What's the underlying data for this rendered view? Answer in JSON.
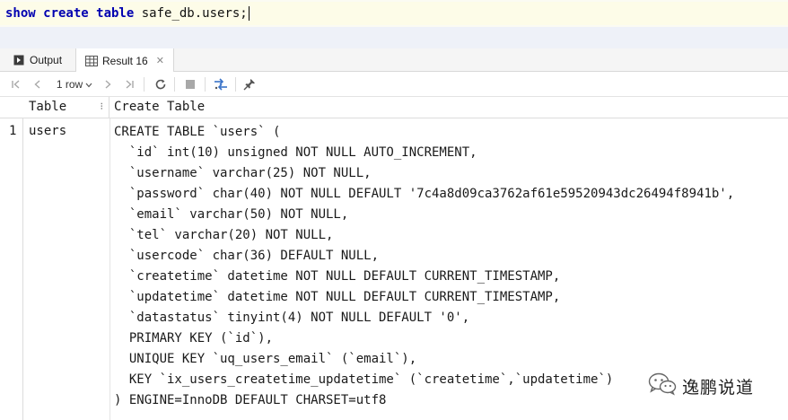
{
  "editor": {
    "keywords": "show create table",
    "target": " safe_db.users;"
  },
  "tabs": [
    {
      "label": "Output",
      "icon": "output-icon"
    },
    {
      "label": "Result 16",
      "icon": "grid-icon"
    }
  ],
  "toolbar": {
    "rows_label": "1 row"
  },
  "grid": {
    "columns": [
      "Table",
      "Create Table"
    ],
    "row_number": "1",
    "table_name": "users",
    "create_table_lines": [
      "CREATE TABLE `users` (",
      "  `id` int(10) unsigned NOT NULL AUTO_INCREMENT,",
      "  `username` varchar(25) NOT NULL,",
      "  `password` char(40) NOT NULL DEFAULT '7c4a8d09ca3762af61e59520943dc26494f8941b',",
      "  `email` varchar(50) NOT NULL,",
      "  `tel` varchar(20) NOT NULL,",
      "  `usercode` char(36) DEFAULT NULL,",
      "  `createtime` datetime NOT NULL DEFAULT CURRENT_TIMESTAMP,",
      "  `updatetime` datetime NOT NULL DEFAULT CURRENT_TIMESTAMP,",
      "  `datastatus` tinyint(4) NOT NULL DEFAULT '0',",
      "  PRIMARY KEY (`id`),",
      "  UNIQUE KEY `uq_users_email` (`email`),",
      "  KEY `ix_users_createtime_updatetime` (`createtime`,`updatetime`)",
      ") ENGINE=InnoDB DEFAULT CHARSET=utf8"
    ]
  },
  "watermark": {
    "text": "逸鹏说道"
  }
}
